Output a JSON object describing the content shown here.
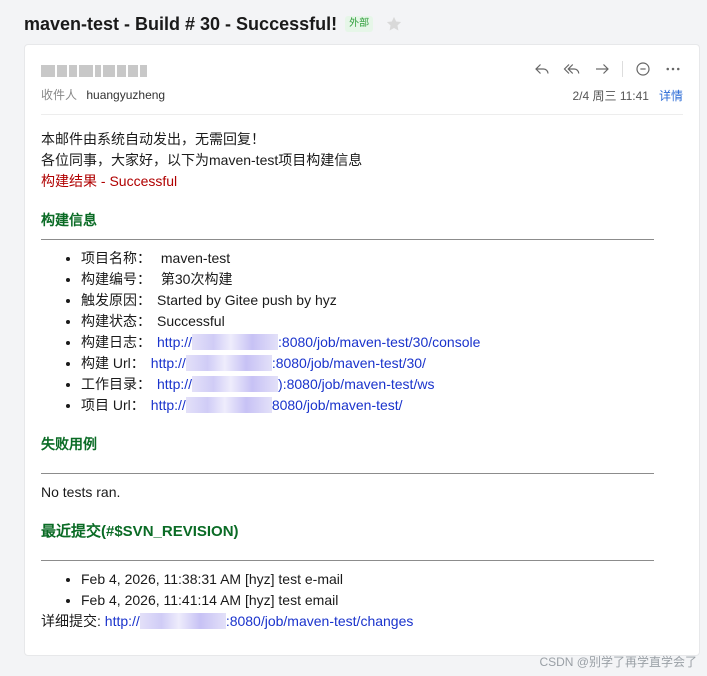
{
  "subject": {
    "title": "maven-test - Build # 30 - Successful!",
    "external_tag": "外部",
    "star_icon": "star-icon"
  },
  "header": {
    "recipient_label": "收件人",
    "recipient_name": "huangyuzheng",
    "datetime": "2/4 周三 11:41",
    "detail_link": "详情",
    "actions": [
      "reply-icon",
      "reply-all-icon",
      "forward-icon",
      "comment-icon",
      "more-icon"
    ]
  },
  "body": {
    "intro1": "本邮件由系统自动发出，无需回复！",
    "intro2": "各位同事，大家好，以下为maven-test项目构建信息",
    "result": "构建结果 - Successful",
    "build_info_title": "构建信息",
    "build_items": [
      {
        "key": "项目名称：",
        "value": "maven-test"
      },
      {
        "key": "构建编号：",
        "value": "第30次构建"
      },
      {
        "key": "触发原因：",
        "value": "Started by Gitee push by hyz"
      },
      {
        "key": "构建状态：",
        "value": "Successful"
      },
      {
        "key": "构建日志：",
        "link_prefix": "http://",
        "link_suffix": ":8080/job/maven-test/30/console"
      },
      {
        "key": "构建 Url：",
        "link_prefix": "http://",
        "link_suffix": ":8080/job/maven-test/30/"
      },
      {
        "key": "工作目录：",
        "link_prefix": "http://",
        "link_suffix": "):8080/job/maven-test/ws"
      },
      {
        "key": "项目 Url：",
        "link_prefix": "http://",
        "link_suffix": "8080/job/maven-test/"
      }
    ],
    "fail_title": "失败用例",
    "no_tests": "No tests ran.",
    "commits_title": "最近提交(#$SVN_REVISION)",
    "commits": [
      "Feb 4, 2026, 11:38:31 AM [hyz] test e-mail",
      "Feb 4, 2026, 11:41:14 AM [hyz] test email"
    ],
    "details_label": "详细提交:",
    "details_link_prefix": "http://",
    "details_link_suffix": ":8080/job/maven-test/changes"
  },
  "watermark": "CSDN @别学了再学直学会了",
  "colors": {
    "section_green": "#0a6b25",
    "result_red": "#b00000",
    "link_blue": "#1a33cc"
  }
}
